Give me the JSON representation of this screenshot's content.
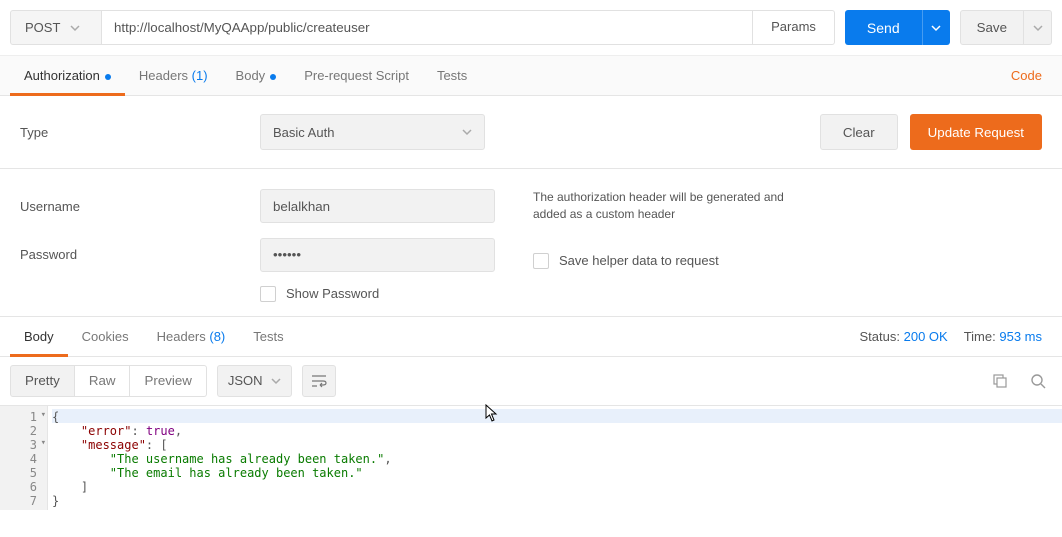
{
  "request": {
    "method": "POST",
    "url": "http://localhost/MyQAApp/public/createuser",
    "params_label": "Params",
    "send_label": "Send",
    "save_label": "Save"
  },
  "req_tabs": {
    "authorization": "Authorization",
    "headers": "Headers",
    "headers_count": "(1)",
    "body": "Body",
    "prereq": "Pre-request Script",
    "tests": "Tests",
    "code": "Code"
  },
  "auth": {
    "type_label": "Type",
    "type_value": "Basic Auth",
    "clear": "Clear",
    "update": "Update Request",
    "username_label": "Username",
    "username_value": "belalkhan",
    "password_label": "Password",
    "password_value": "••••••",
    "show_password": "Show Password",
    "helper1": "The authorization header will be generated and added as a custom header",
    "save_helper": "Save helper data to request"
  },
  "resp_tabs": {
    "body": "Body",
    "cookies": "Cookies",
    "headers": "Headers",
    "headers_count": "(8)",
    "tests": "Tests"
  },
  "resp_meta": {
    "status_label": "Status:",
    "status_value": "200 OK",
    "time_label": "Time:",
    "time_value": "953 ms"
  },
  "body_fmt": {
    "pretty": "Pretty",
    "raw": "Raw",
    "preview": "Preview",
    "lang": "JSON"
  },
  "gutter": {
    "l1": "1",
    "l2": "2",
    "l3": "3",
    "l4": "4",
    "l5": "5",
    "l6": "6",
    "l7": "7"
  },
  "code": {
    "l1": "{",
    "l2a": "    \"error\"",
    "l2b": ": ",
    "l2c": "true",
    "l2d": ",",
    "l3a": "    \"message\"",
    "l3b": ": [",
    "l4a": "        \"The username has already been taken.\"",
    "l4b": ",",
    "l5a": "        \"The email has already been taken.\"",
    "l6": "    ]",
    "l7": "}"
  }
}
